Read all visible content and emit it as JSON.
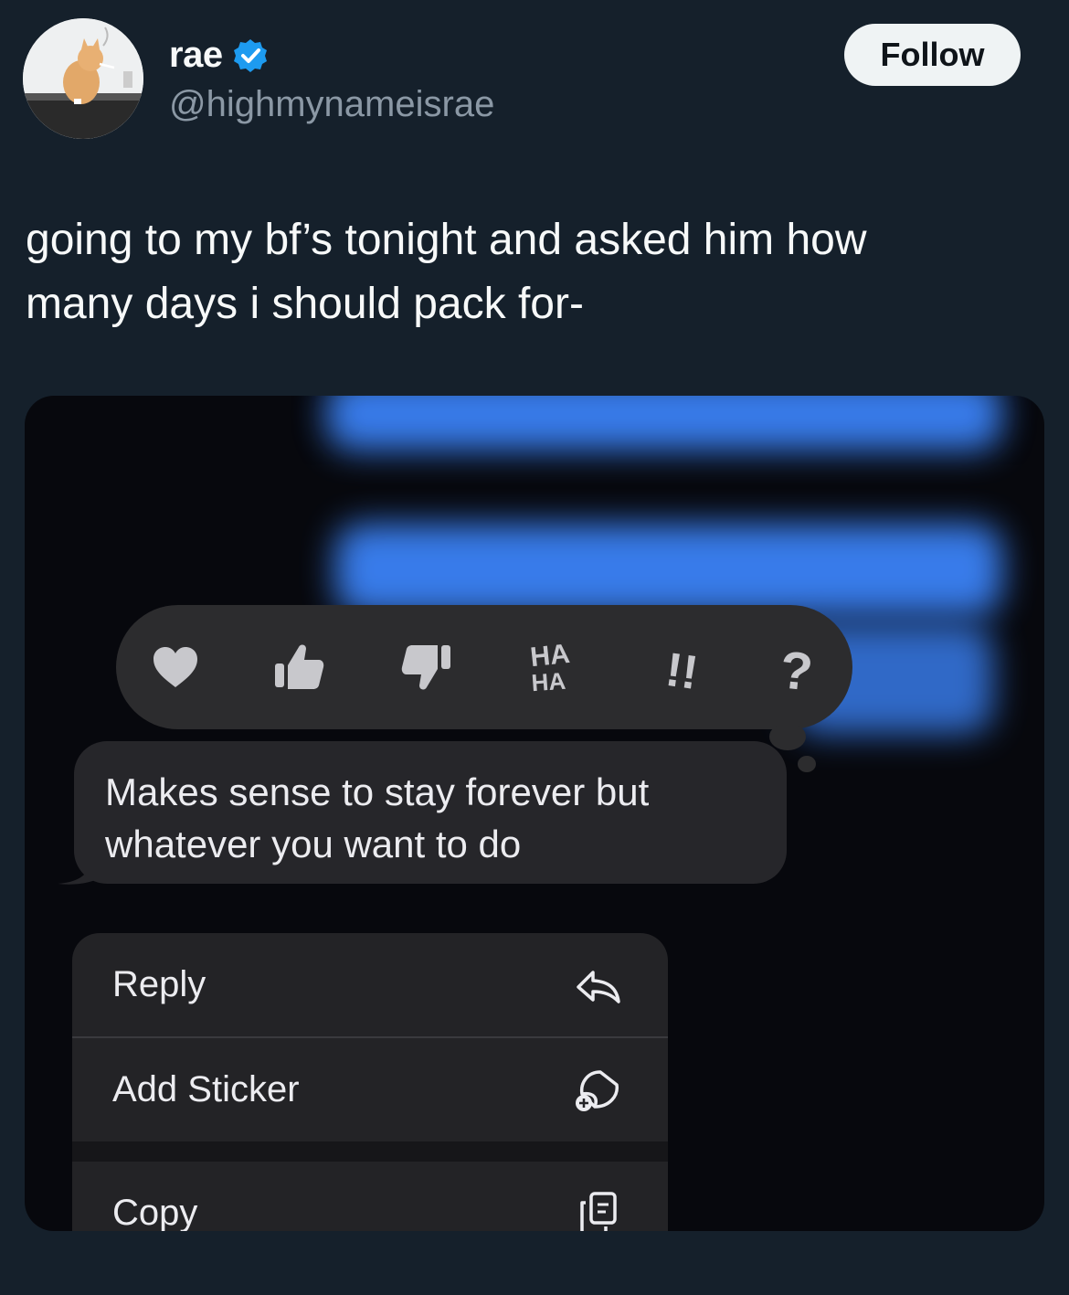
{
  "author": {
    "display_name": "rae",
    "handle": "@highmynameisrae",
    "verified": true,
    "avatar_icon": "cat-avatar"
  },
  "follow_label": "Follow",
  "tweet_text": "going to my bf’s tonight and asked him how\nmany days i should pack for-",
  "media": {
    "tapbacks": [
      {
        "icon": "heart-icon"
      },
      {
        "icon": "thumbs-up-icon"
      },
      {
        "icon": "thumbs-down-icon"
      },
      {
        "icon": "haha-icon",
        "text": [
          "HA",
          "HA"
        ]
      },
      {
        "icon": "exclamation-icon",
        "text": "!!"
      },
      {
        "icon": "question-icon",
        "text": "?"
      }
    ],
    "message_text": "Makes sense to stay forever  but\nwhatever you want to do",
    "menu": [
      {
        "label": "Reply",
        "icon": "reply-icon"
      },
      {
        "label": "Add Sticker",
        "icon": "add-sticker-icon"
      },
      {
        "label": "Copy",
        "icon": "copy-icon"
      }
    ]
  },
  "colors": {
    "background": "#15202b",
    "verified_badge": "#1d9bf0",
    "imessage_blue": "#3b82f6",
    "follow_bg": "#eff3f4"
  }
}
